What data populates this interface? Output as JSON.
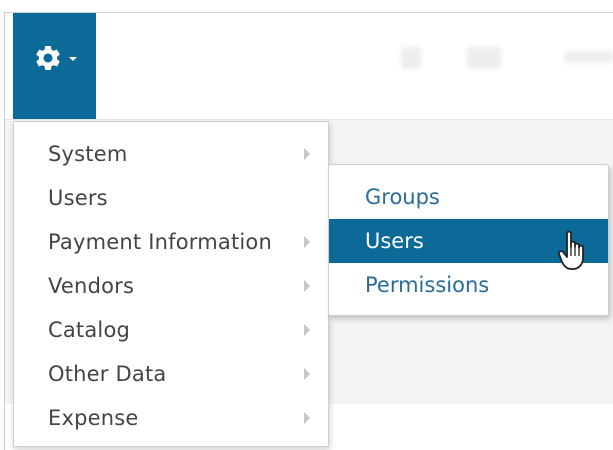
{
  "toolbar": {
    "settings_icon": "gear-icon",
    "settings_caret_icon": "caret-down-icon",
    "accent_color": "#0b6a98"
  },
  "menu": {
    "items": [
      {
        "label": "System",
        "has_submenu": true
      },
      {
        "label": "Users",
        "has_submenu": false
      },
      {
        "label": "Payment Information",
        "has_submenu": true
      },
      {
        "label": "Vendors",
        "has_submenu": true
      },
      {
        "label": "Catalog",
        "has_submenu": true
      },
      {
        "label": "Other Data",
        "has_submenu": true
      },
      {
        "label": "Expense",
        "has_submenu": true
      }
    ],
    "submenu_arrow_icon": "chevron-right-icon"
  },
  "submenu": {
    "items": [
      {
        "label": "Groups",
        "active": false
      },
      {
        "label": "Users",
        "active": true
      },
      {
        "label": "Permissions",
        "active": false
      }
    ],
    "highlight_color": "#0b6a98",
    "link_color": "#2a6c99"
  },
  "pointer": {
    "icon": "hand-pointer-icon"
  }
}
